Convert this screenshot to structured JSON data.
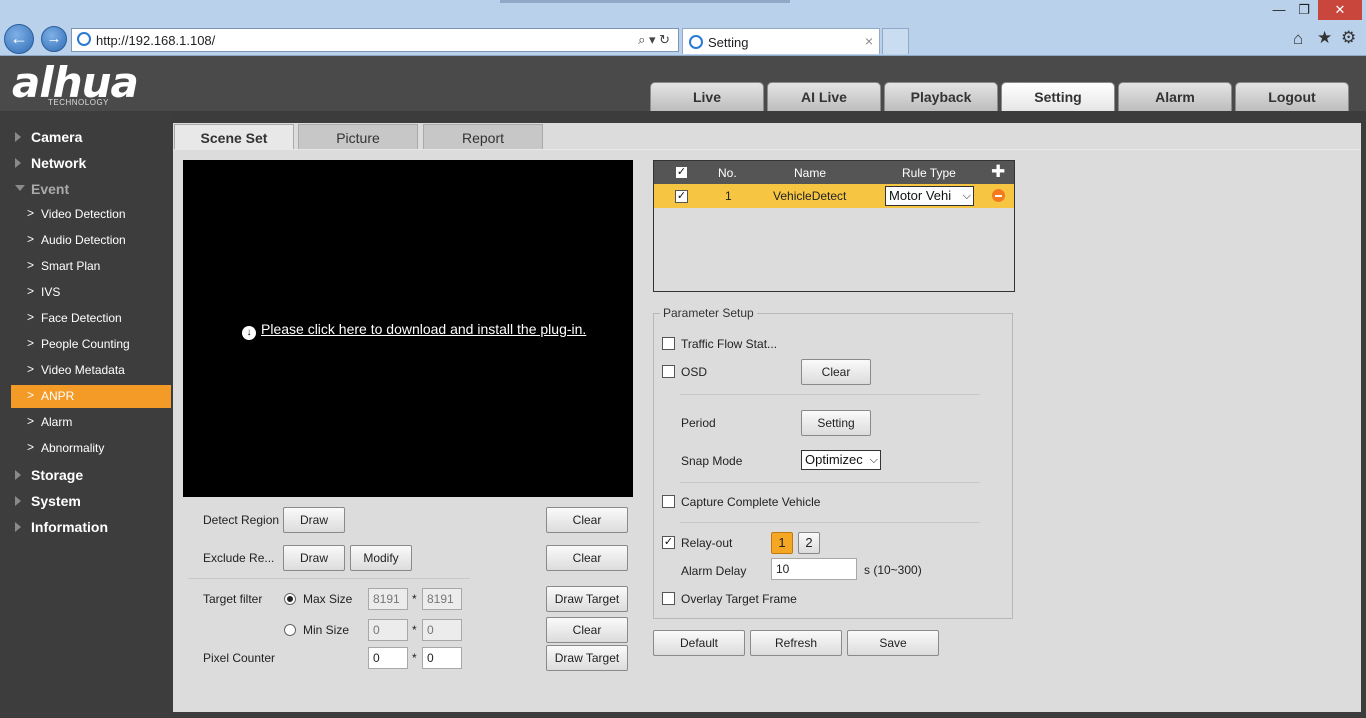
{
  "browser": {
    "url": "http://192.168.1.108/",
    "tab_title": "Setting",
    "address_icons": "⌕ ▾ ↻",
    "tab_close": "×"
  },
  "header": {
    "logo": "alhua",
    "logo_sub": "TECHNOLOGY",
    "tabs": [
      "Live",
      "AI Live",
      "Playback",
      "Setting",
      "Alarm",
      "Logout"
    ]
  },
  "sidebar": {
    "sections": [
      "Camera",
      "Network",
      "Event",
      "Storage",
      "System",
      "Information"
    ],
    "event_items": [
      "Video Detection",
      "Audio Detection",
      "Smart Plan",
      "IVS",
      "Face Detection",
      "People Counting",
      "Video Metadata",
      "ANPR",
      "Alarm",
      "Abnormality"
    ]
  },
  "subtabs": [
    "Scene Set",
    "Picture",
    "Report"
  ],
  "video": {
    "plugin_link": "Please click here to download and install the plug-in."
  },
  "left_controls": {
    "detect_region": "Detect Region",
    "exclude_region": "Exclude Re...",
    "target_filter": "Target filter",
    "max_size": "Max Size",
    "min_size": "Min Size",
    "pixel_counter": "Pixel Counter",
    "draw": "Draw",
    "modify": "Modify",
    "clear": "Clear",
    "draw_target": "Draw Target",
    "times": "*",
    "max_w": "8191",
    "max_h": "8191",
    "min_w": "0",
    "min_h": "0",
    "pix_w": "0",
    "pix_h": "0"
  },
  "rule_table": {
    "headers": [
      "No.",
      "Name",
      "Rule Type"
    ],
    "row": {
      "no": "1",
      "name": "VehicleDetect",
      "rule_type": "Motor Vehi"
    }
  },
  "param": {
    "legend": "Parameter Setup",
    "traffic_flow": "Traffic Flow Stat...",
    "osd": "OSD",
    "clear": "Clear",
    "period": "Period",
    "setting": "Setting",
    "snap_mode": "Snap Mode",
    "snap_value": "Optimizec",
    "capture_complete": "Capture Complete Vehicle",
    "relay_out": "Relay-out",
    "relay_1": "1",
    "relay_2": "2",
    "alarm_delay": "Alarm Delay",
    "alarm_delay_value": "10",
    "alarm_delay_unit": "s (10~300)",
    "overlay": "Overlay Target Frame"
  },
  "footer_buttons": {
    "default": "Default",
    "refresh": "Refresh",
    "save": "Save"
  },
  "colors": {
    "accent": "#f39a27",
    "selected_row": "#f6c643",
    "header_bg": "#4a4a4a"
  }
}
